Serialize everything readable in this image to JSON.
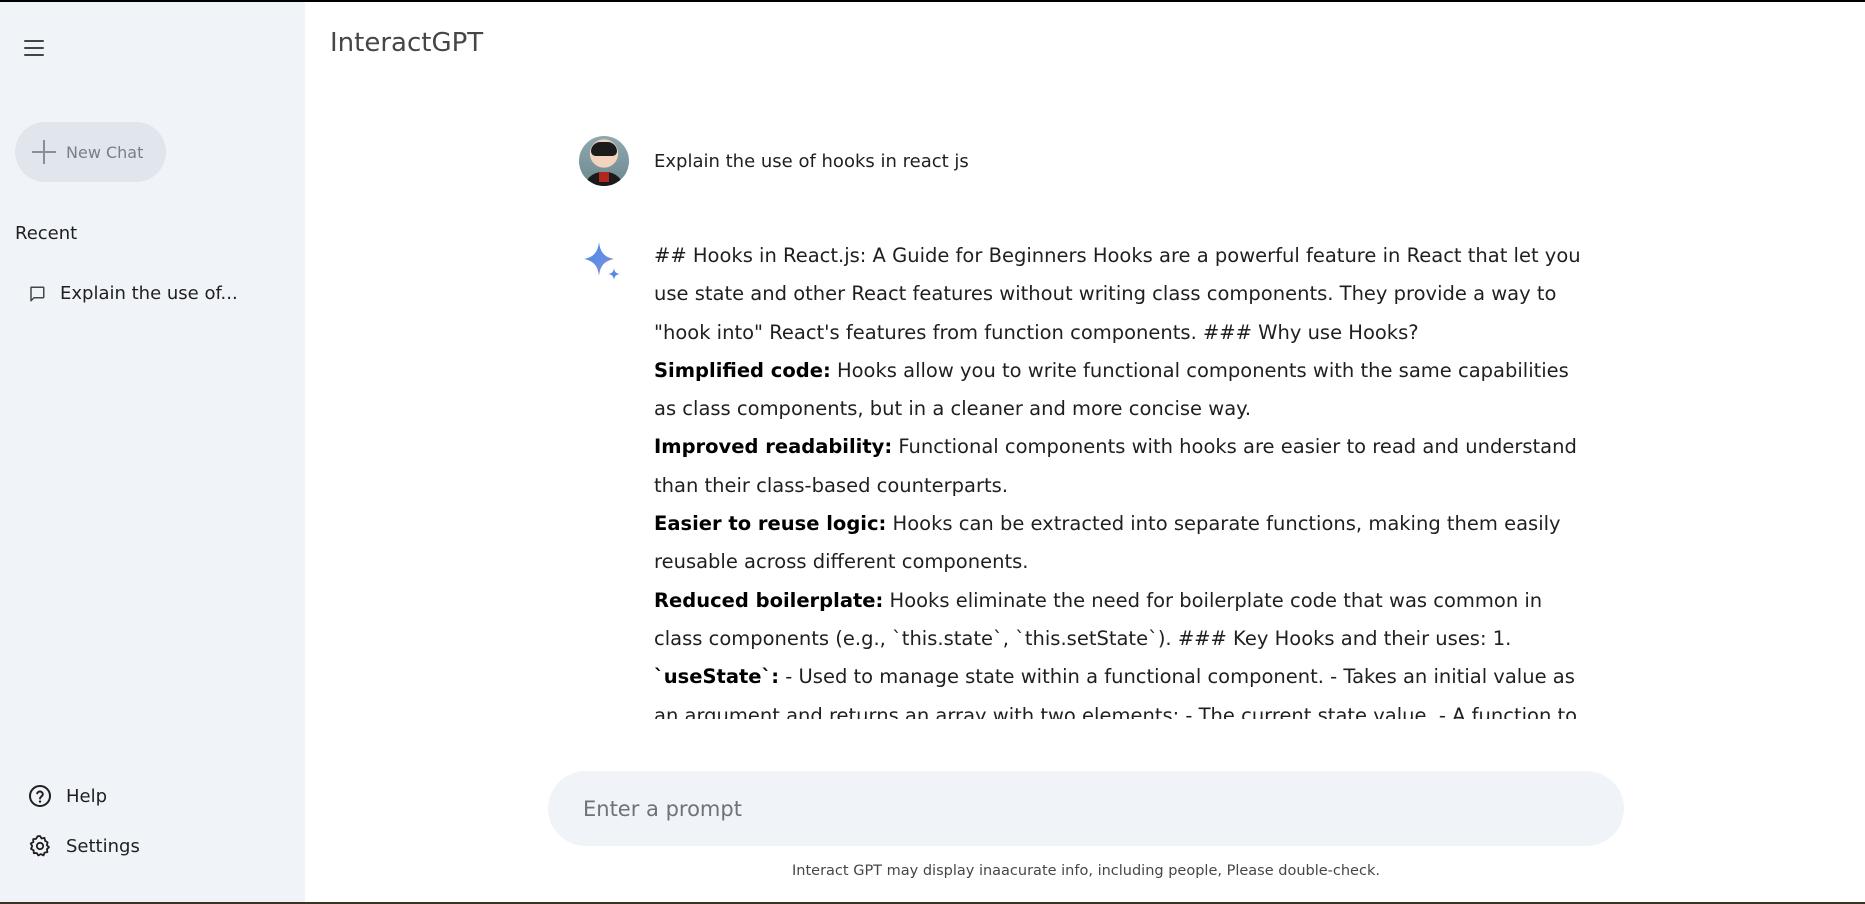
{
  "app": {
    "title": "InteractGPT"
  },
  "sidebar": {
    "new_chat_label": "New Chat",
    "recent_heading": "Recent",
    "recent_items": [
      {
        "label": "Explain the use of..."
      }
    ],
    "help_label": "Help",
    "settings_label": "Settings"
  },
  "conversation": {
    "user_message": "Explain the use of hooks in react js",
    "response": {
      "intro": "## Hooks in React.js: A Guide for Beginners Hooks are a powerful feature in React that let you use state and other React features without writing class components. They provide a way to \"hook into\" React's features from function components. ### Why use Hooks?",
      "points": [
        {
          "bold": "Simplified code:",
          "text": " Hooks allow you to write functional components with the same capabilities as class components, but in a cleaner and more concise way."
        },
        {
          "bold": "Improved readability:",
          "text": " Functional components with hooks are easier to read and understand than their class-based counterparts."
        },
        {
          "bold": "Easier to reuse logic:",
          "text": " Hooks can be extracted into separate functions, making them easily reusable across different components."
        }
      ],
      "last_bold": "Reduced boilerplate:",
      "last_text": " Hooks eliminate the need for boilerplate code that was common in class components (e.g., `this.state`, `this.setState`). ### Key Hooks and their uses: 1. ",
      "use_state_bold": "`useState`:",
      "use_state_text": " - Used to manage state within a functional component. - Takes an initial value as an argument and returns an array with two elements: - The current state value. - A function to update the state. - Example:"
    }
  },
  "prompt": {
    "placeholder": "Enter a prompt",
    "value": ""
  },
  "footer": {
    "disclaimer": "Interact GPT may display inaacurate info, including people, Please double-check."
  },
  "icons": {
    "menu": "menu-icon",
    "plus": "plus-icon",
    "chat": "chat-icon",
    "help": "help-icon",
    "settings": "gear-icon",
    "ai": "sparkle-icon",
    "avatar": "user-avatar"
  },
  "colors": {
    "sidebar_bg": "#f0f4f9",
    "new_chat_bg": "#e1e6ed",
    "prompt_bg": "#f0f4f9",
    "sparkle_blue": "#4a7bd6"
  }
}
